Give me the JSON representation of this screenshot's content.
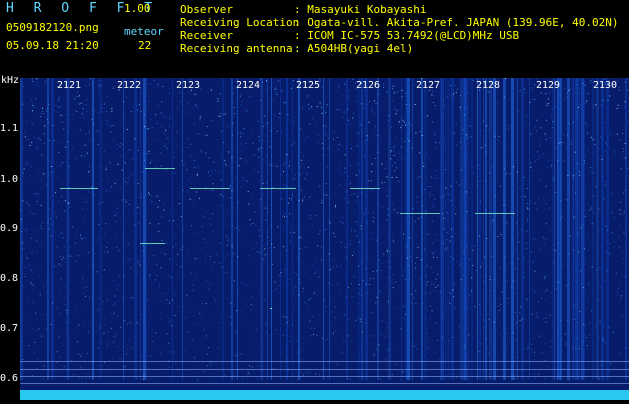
{
  "header": {
    "app_title": "H R O F F T",
    "app_version": "1.00",
    "filename": "0509182120.png",
    "meteor_label": "meteor",
    "datetime": "05.09.18 21:20",
    "meteor_count": "22"
  },
  "info": {
    "observer_label": "Observer",
    "observer_value": ": Masayuki Kobayashi",
    "location_label": "Receiving Location",
    "location_value": ": Ogata-vill. Akita-Pref. JAPAN (139.96E, 40.02N)",
    "receiver_label": "Receiver",
    "receiver_value": ": ICOM IC-575 53.7492(@LCD)MHz USB",
    "antenna_label": "Receiving antenna",
    "antenna_value": ": A504HB(yagi 4el)"
  },
  "axes": {
    "y_unit": "kHz",
    "y_ticks": [
      "1.1",
      "1.0",
      "0.9",
      "0.8",
      "0.7",
      "0.6"
    ],
    "x_ticks": [
      "2121",
      "2122",
      "2123",
      "2124",
      "2125",
      "2126",
      "2127",
      "2128",
      "2129",
      "2130"
    ]
  },
  "colors": {
    "background": "#000000",
    "spectrogram_base": "#071c6a",
    "text_cyan": "#5fd7ff",
    "text_yellow": "#ffff00"
  }
}
